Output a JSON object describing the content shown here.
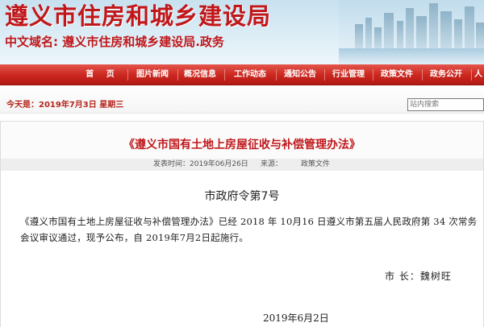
{
  "header": {
    "site_title": "遵义市住房和城乡建设局",
    "domain_label": "中文域名:",
    "domain_value": "遵义市住房和城乡建设局.政务"
  },
  "nav": {
    "items": [
      "首 页",
      "图片新闻",
      "概况信息",
      "工作动态",
      "通知公告",
      "行业管理",
      "政策文件",
      "政务公开",
      "人"
    ]
  },
  "datebar": {
    "date_text": "今天是：2019年7月3日 星期三",
    "search_placeholder": "站内搜索"
  },
  "article": {
    "title": "《遵义市国有土地上房屋征收与补偿管理办法》",
    "meta": {
      "publish_label": "发表时间：2019年06月26日",
      "source_label": "来源：",
      "category": "政策文件"
    },
    "decree_number": "市政府令第7号",
    "body": "《遵义市国有土地上房屋征收与补偿管理办法》已经 2018 年 10月16 日遵义市第五届人民政府第 34 次常务会议审议通过，现予公布，自 2019年7月2日起施行。",
    "signer": "市 长：魏树旺",
    "sign_date": "2019年6月2日"
  },
  "colors": {
    "brand_red": "#c0171a",
    "nav_red": "#c9261e",
    "header_blue": "#c8e1ef"
  }
}
